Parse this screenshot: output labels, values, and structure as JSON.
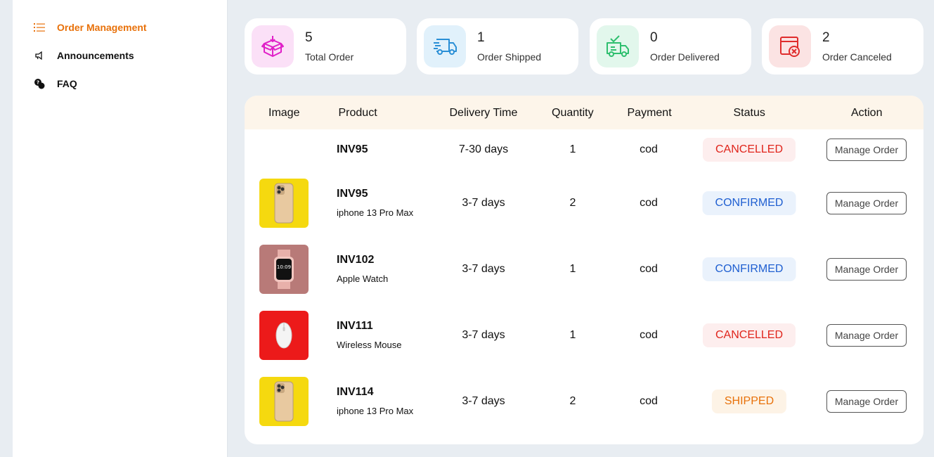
{
  "sidebar": {
    "items": [
      {
        "label": "Order Management",
        "icon": "list-icon",
        "active": true
      },
      {
        "label": "Announcements",
        "icon": "megaphone-icon",
        "active": false
      },
      {
        "label": "FAQ",
        "icon": "chat-bubbles-icon",
        "active": false
      }
    ]
  },
  "stats": [
    {
      "value": "5",
      "label": "Total Order",
      "icon": "box-icon",
      "color": "#e020c8",
      "bg": "#fbe0f7"
    },
    {
      "value": "1",
      "label": "Order Shipped",
      "icon": "truck-icon",
      "color": "#2a8fd6",
      "bg": "#e1f1fb"
    },
    {
      "value": "0",
      "label": "Order Delivered",
      "icon": "truck-check-icon",
      "color": "#2fbf6f",
      "bg": "#e2f7ec"
    },
    {
      "value": "2",
      "label": "Order Canceled",
      "icon": "cancel-document-icon",
      "color": "#e02c2c",
      "bg": "#fbe3e3"
    }
  ],
  "table": {
    "headers": {
      "image": "Image",
      "product": "Product",
      "delivery": "Delivery Time",
      "quantity": "Quantity",
      "payment": "Payment",
      "status": "Status",
      "action": "Action"
    },
    "rows": [
      {
        "id": "INV95",
        "name": "",
        "delivery": "7-30 days",
        "quantity": "1",
        "payment": "cod",
        "status": "CANCELLED",
        "action": "Manage Order",
        "thumb": "none"
      },
      {
        "id": "INV95",
        "name": "iphone 13 Pro Max",
        "delivery": "3-7 days",
        "quantity": "2",
        "payment": "cod",
        "status": "CONFIRMED",
        "action": "Manage Order",
        "thumb": "phone"
      },
      {
        "id": "INV102",
        "name": "Apple Watch",
        "delivery": "3-7 days",
        "quantity": "1",
        "payment": "cod",
        "status": "CONFIRMED",
        "action": "Manage Order",
        "thumb": "watch"
      },
      {
        "id": "INV111",
        "name": "Wireless Mouse",
        "delivery": "3-7 days",
        "quantity": "1",
        "payment": "cod",
        "status": "CANCELLED",
        "action": "Manage Order",
        "thumb": "mouse"
      },
      {
        "id": "INV114",
        "name": "iphone 13 Pro Max",
        "delivery": "3-7 days",
        "quantity": "2",
        "payment": "cod",
        "status": "SHIPPED",
        "action": "Manage Order",
        "thumb": "phone"
      }
    ]
  }
}
